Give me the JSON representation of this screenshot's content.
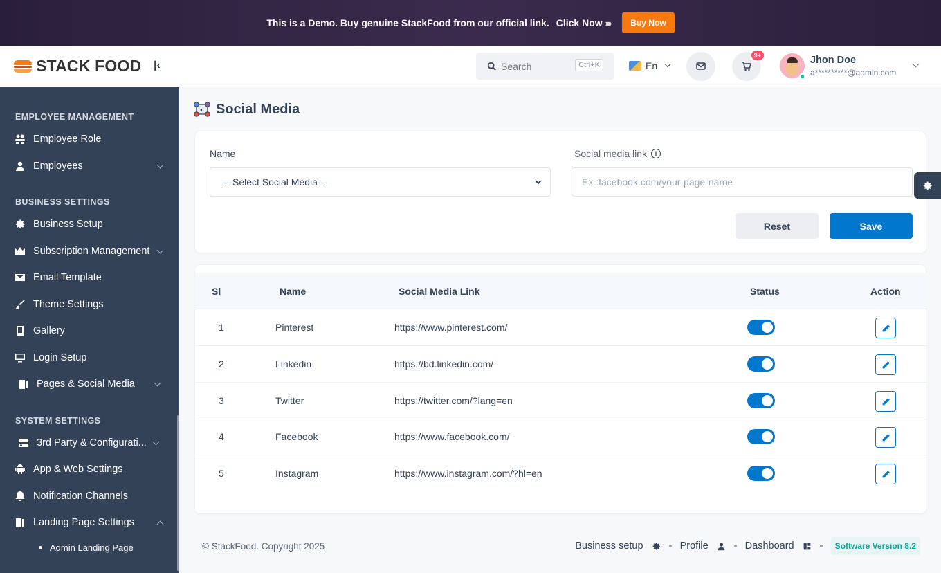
{
  "banner": {
    "message": "This is a Demo. Buy genuine StackFood from our official link.",
    "click_label": "Click Now",
    "buy_label": "Buy Now"
  },
  "brand": {
    "name": "STACK FOOD"
  },
  "sidebar": {
    "sections": [
      {
        "title": "EMPLOYEE MANAGEMENT"
      },
      {
        "title": "BUSINESS SETTINGS"
      },
      {
        "title": "SYSTEM SETTINGS"
      }
    ],
    "items": [
      {
        "label": "Employee Role",
        "icon": "users-role-icon"
      },
      {
        "label": "Employees",
        "icon": "user-icon"
      },
      {
        "label": "Business Setup",
        "icon": "gear-icon"
      },
      {
        "label": "Subscription Management",
        "icon": "crown-icon"
      },
      {
        "label": "Email Template",
        "icon": "envelope-icon"
      },
      {
        "label": "Theme Settings",
        "icon": "brush-icon"
      },
      {
        "label": "Gallery",
        "icon": "gallery-icon"
      },
      {
        "label": "Login Setup",
        "icon": "monitor-icon"
      },
      {
        "label": "Pages & Social Media",
        "icon": "pages-icon"
      },
      {
        "label": "3rd Party & Configurati...",
        "icon": "server-icon"
      },
      {
        "label": "App & Web Settings",
        "icon": "android-icon"
      },
      {
        "label": "Notification Channels",
        "icon": "bell-icon"
      },
      {
        "label": "Landing Page Settings",
        "icon": "pages-icon"
      }
    ],
    "subitems": [
      {
        "label": "Admin Landing Page"
      }
    ]
  },
  "topbar": {
    "search_placeholder": "Search",
    "search_shortcut": "Ctrl+K",
    "language": "En",
    "cart_badge": "9+",
    "user_name": "Jhon Doe",
    "user_email": "a**********@admin.com"
  },
  "page": {
    "title": "Social Media"
  },
  "form": {
    "name_label": "Name",
    "name_select_value": "---Select Social Media---",
    "link_label": "Social media link",
    "link_placeholder": "Ex :facebook.com/your-page-name",
    "reset_label": "Reset",
    "save_label": "Save"
  },
  "table": {
    "headers": {
      "sl": "Sl",
      "name": "Name",
      "link": "Social Media Link",
      "status": "Status",
      "action": "Action"
    },
    "rows": [
      {
        "sl": "1",
        "name": "Pinterest",
        "link": "https://www.pinterest.com/",
        "status": true
      },
      {
        "sl": "2",
        "name": "Linkedin",
        "link": "https://bd.linkedin.com/",
        "status": true
      },
      {
        "sl": "3",
        "name": "Twitter",
        "link": "https://twitter.com/?lang=en",
        "status": true
      },
      {
        "sl": "4",
        "name": "Facebook",
        "link": "https://www.facebook.com/",
        "status": true
      },
      {
        "sl": "5",
        "name": "Instagram",
        "link": "https://www.instagram.com/?hl=en",
        "status": true
      }
    ]
  },
  "footer": {
    "copyright": "© StackFood. Copyright 2025",
    "links": [
      {
        "label": "Business setup",
        "icon": "gear-icon"
      },
      {
        "label": "Profile",
        "icon": "user-icon"
      },
      {
        "label": "Dashboard",
        "icon": "dashboard-icon"
      }
    ],
    "version": "Software Version 8.2"
  },
  "colors": {
    "sidebar": "#334257",
    "primary": "#0177cd",
    "accent": "#f77a10"
  }
}
